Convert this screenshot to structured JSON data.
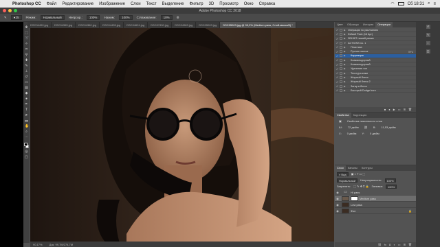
{
  "menubar": {
    "app": "Photoshop CC",
    "items": [
      "Файл",
      "Редактирование",
      "Изображение",
      "Слои",
      "Текст",
      "Выделение",
      "Фильтр",
      "3D",
      "Просмотр",
      "Окно",
      "Справка"
    ],
    "clock": "Сб 18:31"
  },
  "window": {
    "title": "Adobe Photoshop CC 2018"
  },
  "options": {
    "mode_label": "Режим:",
    "mode_value": "Нормальный",
    "opacity_label": "Непрозр.:",
    "opacity_value": "100%",
    "pressure_label": "Нажим:",
    "pressure_value": "100%",
    "smooth_label": "Сглаживание:",
    "smooth_value": "10%"
  },
  "tabs": [
    "DSC04490.jpg",
    "DSC04365.jpg",
    "DSC04360.jpg",
    "DSC04435.jpg",
    "DSC04624.jpg",
    "DSC07430.jpg",
    "DSC04969.jpg",
    "DSC05003.jpg",
    "DSC05003.jpg @ 90,2% (Medium pass, Слой-маска/8) *"
  ],
  "statusbar": {
    "zoom": "90,17%",
    "doc": "Док: 99,7M/274,7M"
  },
  "panel_tabs": [
    "Цвет",
    "Образцы",
    "История",
    "Операции"
  ],
  "actions": [
    {
      "label": "Операции по умолчанию",
      "checked": true,
      "level": 0,
      "key": ""
    },
    {
      "label": "Default Pack (16 Apr)",
      "checked": true,
      "level": 0,
      "key": ""
    },
    {
      "label": "ЗВНЖТ нашей рамки",
      "checked": true,
      "level": 0,
      "key": ""
    },
    {
      "label": "ACTIONS no. 1",
      "checked": true,
      "level": 0,
      "key": ""
    },
    {
      "label": "Пластика",
      "checked": true,
      "level": 1,
      "key": ""
    },
    {
      "label": "Ручная частка",
      "checked": true,
      "level": 1,
      "key": "⇧F1"
    },
    {
      "label": "Коррекция",
      "checked": true,
      "level": 1,
      "key": "",
      "selected": true
    },
    {
      "label": "Коажальдорный",
      "checked": true,
      "level": 1,
      "key": ""
    },
    {
      "label": "Коажальдорный",
      "checked": true,
      "level": 1,
      "key": ""
    },
    {
      "label": "Удаление тон",
      "checked": true,
      "level": 1,
      "key": ""
    },
    {
      "label": "Текстура кожи",
      "checked": true,
      "level": 1,
      "key": ""
    },
    {
      "label": "Жирный блеск",
      "checked": true,
      "level": 1,
      "key": ""
    },
    {
      "label": "Жирный блеск 2",
      "checked": true,
      "level": 1,
      "key": ""
    },
    {
      "label": "Загар в блеск",
      "checked": true,
      "level": 1,
      "key": ""
    },
    {
      "label": "Быстрый Dodge burn",
      "checked": true,
      "level": 1,
      "key": ""
    }
  ],
  "properties": {
    "tabs": [
      "Свойства",
      "Коррекция"
    ],
    "title": "Свойства пиксельного слоя",
    "w_label": "Ш:",
    "w_value": "72 дюйм",
    "h_label": "В:",
    "h_value": "11,53 дюйм",
    "x_label": "X:",
    "x_value": "0 дюйм",
    "y_label": "Y:",
    "y_value": "0 дюйм"
  },
  "layers_panel": {
    "tabs": [
      "Слои",
      "Каналы",
      "Контуры"
    ],
    "filter_label": "Вид",
    "blend": "Нормальный",
    "opacity_label": "Непрозрачность:",
    "opacity_value": "100%",
    "lock_label": "Закрепить:",
    "fill_label": "Заливка:",
    "fill_value": "100%"
  },
  "layers": [
    {
      "name": "Hi pass",
      "thumb": "folder",
      "selected": false
    },
    {
      "name": "Medium pass",
      "thumb": "white",
      "selected": true
    },
    {
      "name": "Low pass",
      "thumb": "dark",
      "selected": false
    },
    {
      "name": "Фон",
      "thumb": "dark",
      "selected": false
    }
  ],
  "colors": {
    "accent": "#2c5fa0",
    "panel": "#535353",
    "canvas_bg": "#2a1e17"
  }
}
